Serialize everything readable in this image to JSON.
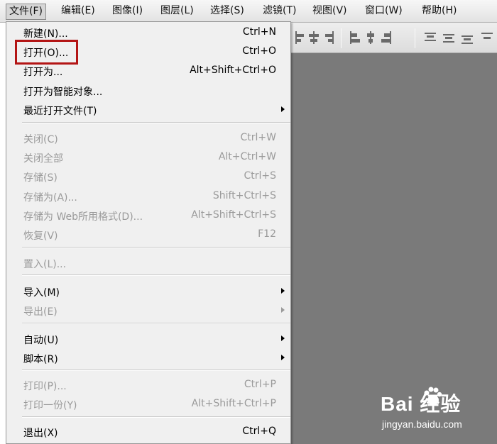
{
  "menubar": {
    "items": [
      {
        "label": "文件(F)"
      },
      {
        "label": "编辑(E)"
      },
      {
        "label": "图像(I)"
      },
      {
        "label": "图层(L)"
      },
      {
        "label": "选择(S)"
      },
      {
        "label": "滤镜(T)"
      },
      {
        "label": "视图(V)"
      },
      {
        "label": "窗口(W)"
      },
      {
        "label": "帮助(H)"
      }
    ]
  },
  "file_menu": {
    "items": [
      {
        "label": "新建(N)...",
        "shortcut": "Ctrl+N"
      },
      {
        "label": "打开(O)...",
        "shortcut": "Ctrl+O"
      },
      {
        "label": "打开为...",
        "shortcut": "Alt+Shift+Ctrl+O"
      },
      {
        "label": "打开为智能对象..."
      },
      {
        "label": "最近打开文件(T)"
      },
      {
        "label": "关闭(C)",
        "shortcut": "Ctrl+W"
      },
      {
        "label": "关闭全部",
        "shortcut": "Alt+Ctrl+W"
      },
      {
        "label": "存储(S)",
        "shortcut": "Ctrl+S"
      },
      {
        "label": "存储为(A)...",
        "shortcut": "Shift+Ctrl+S"
      },
      {
        "label": "存储为 Web所用格式(D)...",
        "shortcut": "Alt+Shift+Ctrl+S"
      },
      {
        "label": "恢复(V)",
        "shortcut": "F12"
      },
      {
        "label": "置入(L)..."
      },
      {
        "label": "导入(M)"
      },
      {
        "label": "导出(E)"
      },
      {
        "label": "自动(U)"
      },
      {
        "label": "脚本(R)"
      },
      {
        "label": "打印(P)...",
        "shortcut": "Ctrl+P"
      },
      {
        "label": "打印一份(Y)",
        "shortcut": "Alt+Shift+Ctrl+P"
      },
      {
        "label": "退出(X)",
        "shortcut": "Ctrl+Q"
      }
    ]
  },
  "watermark": {
    "logo": "Bai  经验",
    "url": "jingyan.baidu.com"
  },
  "colors": {
    "workspace": "#7a7a7a",
    "highlight_box": "#b31515",
    "disabled_text": "#9a9a9a"
  }
}
